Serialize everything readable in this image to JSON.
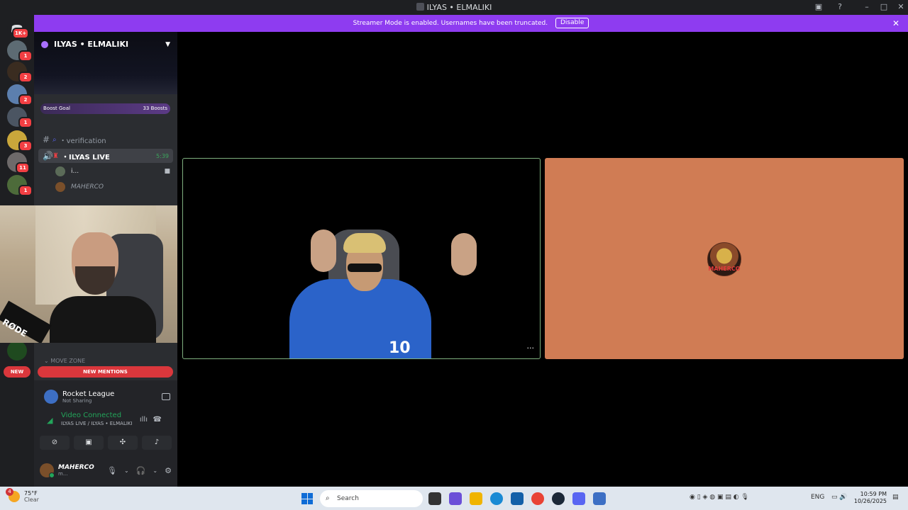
{
  "window": {
    "title": "ILYAS • ELMALIKI"
  },
  "rail": {
    "home_badge": "1K+",
    "servers": [
      {
        "badge": "1",
        "color": "#5d6b73"
      },
      {
        "badge": "2",
        "color": "#3a2c20"
      },
      {
        "badge": "2",
        "color": "#5c7fae"
      },
      {
        "badge": "1",
        "color": "#4b5562"
      },
      {
        "badge": "3",
        "color": "#c9a73b"
      },
      {
        "badge": "11",
        "color": "#6e6a6a"
      },
      {
        "badge": "1",
        "color": "#4d6b3a"
      }
    ]
  },
  "streamer_banner": {
    "text": "Streamer Mode is enabled. Usernames have been truncated.",
    "button": "Disable"
  },
  "server": {
    "name": "ILYAS • ELMALIKI",
    "boost_goal": "Boost Goal",
    "boost_count": "33 Boosts"
  },
  "channels": {
    "verification": "・verification",
    "live_channel": "・ILYAS LIVE",
    "live_time": "5:39",
    "member1": "i...",
    "member2": "MAHERCO",
    "move_zone": "MOVE ZONE",
    "new_pill": "NEW",
    "new_mentions": "NEW MENTIONS"
  },
  "activity": {
    "game": "Rocket League",
    "game_status": "Not Sharing",
    "voice_status": "Video Connected",
    "voice_location": "ILYAS LIVE / ILYAS • ELMALIKI"
  },
  "user": {
    "name": "MAHERCO",
    "status": "m..."
  },
  "stage": {
    "tile1_jersey": "10",
    "tile2_name": "MAHERCO",
    "tile2_bg": "#d07c54"
  },
  "facecam": {
    "mic_brand": "RØDE"
  },
  "taskbar": {
    "weather_badge": "4",
    "temp": "75°F",
    "condition": "Clear",
    "search": "Search",
    "lang": "ENG",
    "time": "10:59 PM",
    "date": "10/26/2025"
  }
}
